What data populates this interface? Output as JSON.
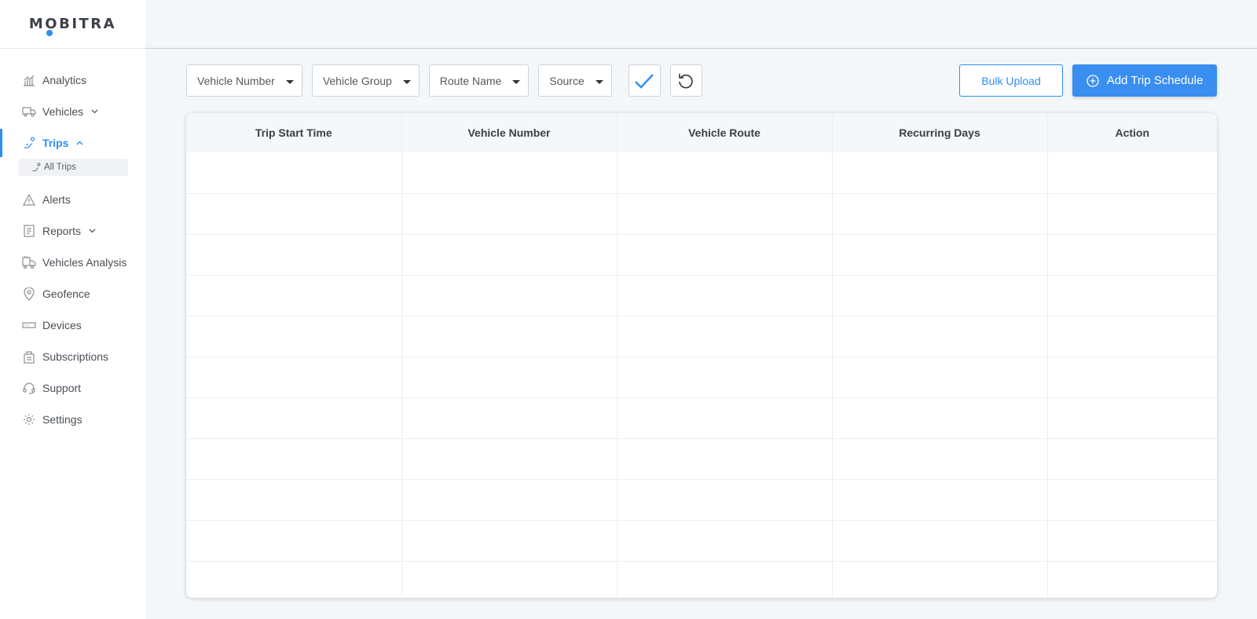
{
  "brand": {
    "logo_text": "MOBITRA"
  },
  "sidebar": {
    "items": [
      {
        "label": "Analytics",
        "icon": "analytics-icon"
      },
      {
        "label": "Vehicles",
        "icon": "truck-icon",
        "expandable": true
      },
      {
        "label": "Trips",
        "icon": "route-icon",
        "expandable": true,
        "active": true,
        "subitems": [
          {
            "label": "All Trips",
            "icon": "route-icon"
          }
        ]
      },
      {
        "label": "Alerts",
        "icon": "alert-icon"
      },
      {
        "label": "Reports",
        "icon": "report-icon",
        "expandable": true
      },
      {
        "label": "Vehicles Analysis",
        "icon": "vehicle-analysis-icon"
      },
      {
        "label": "Geofence",
        "icon": "location-pin-icon"
      },
      {
        "label": "Devices",
        "icon": "device-icon"
      },
      {
        "label": "Subscriptions",
        "icon": "subscription-icon"
      },
      {
        "label": "Support",
        "icon": "headset-icon"
      },
      {
        "label": "Settings",
        "icon": "gear-icon"
      }
    ]
  },
  "filters": {
    "vehicle_number": "Vehicle Number",
    "vehicle_group": "Vehicle Group",
    "route_name": "Route Name",
    "source": "Source"
  },
  "actions": {
    "bulk_upload": "Bulk Upload",
    "add_trip_schedule": "Add Trip Schedule"
  },
  "table": {
    "columns": [
      "Trip Start Time",
      "Vehicle Number",
      "Vehicle Route",
      "Recurring Days",
      "Action"
    ],
    "rows": []
  },
  "colors": {
    "accent": "#2f8ef3",
    "sidebar_bg": "#ffffff",
    "page_bg": "#f4f7fa"
  }
}
